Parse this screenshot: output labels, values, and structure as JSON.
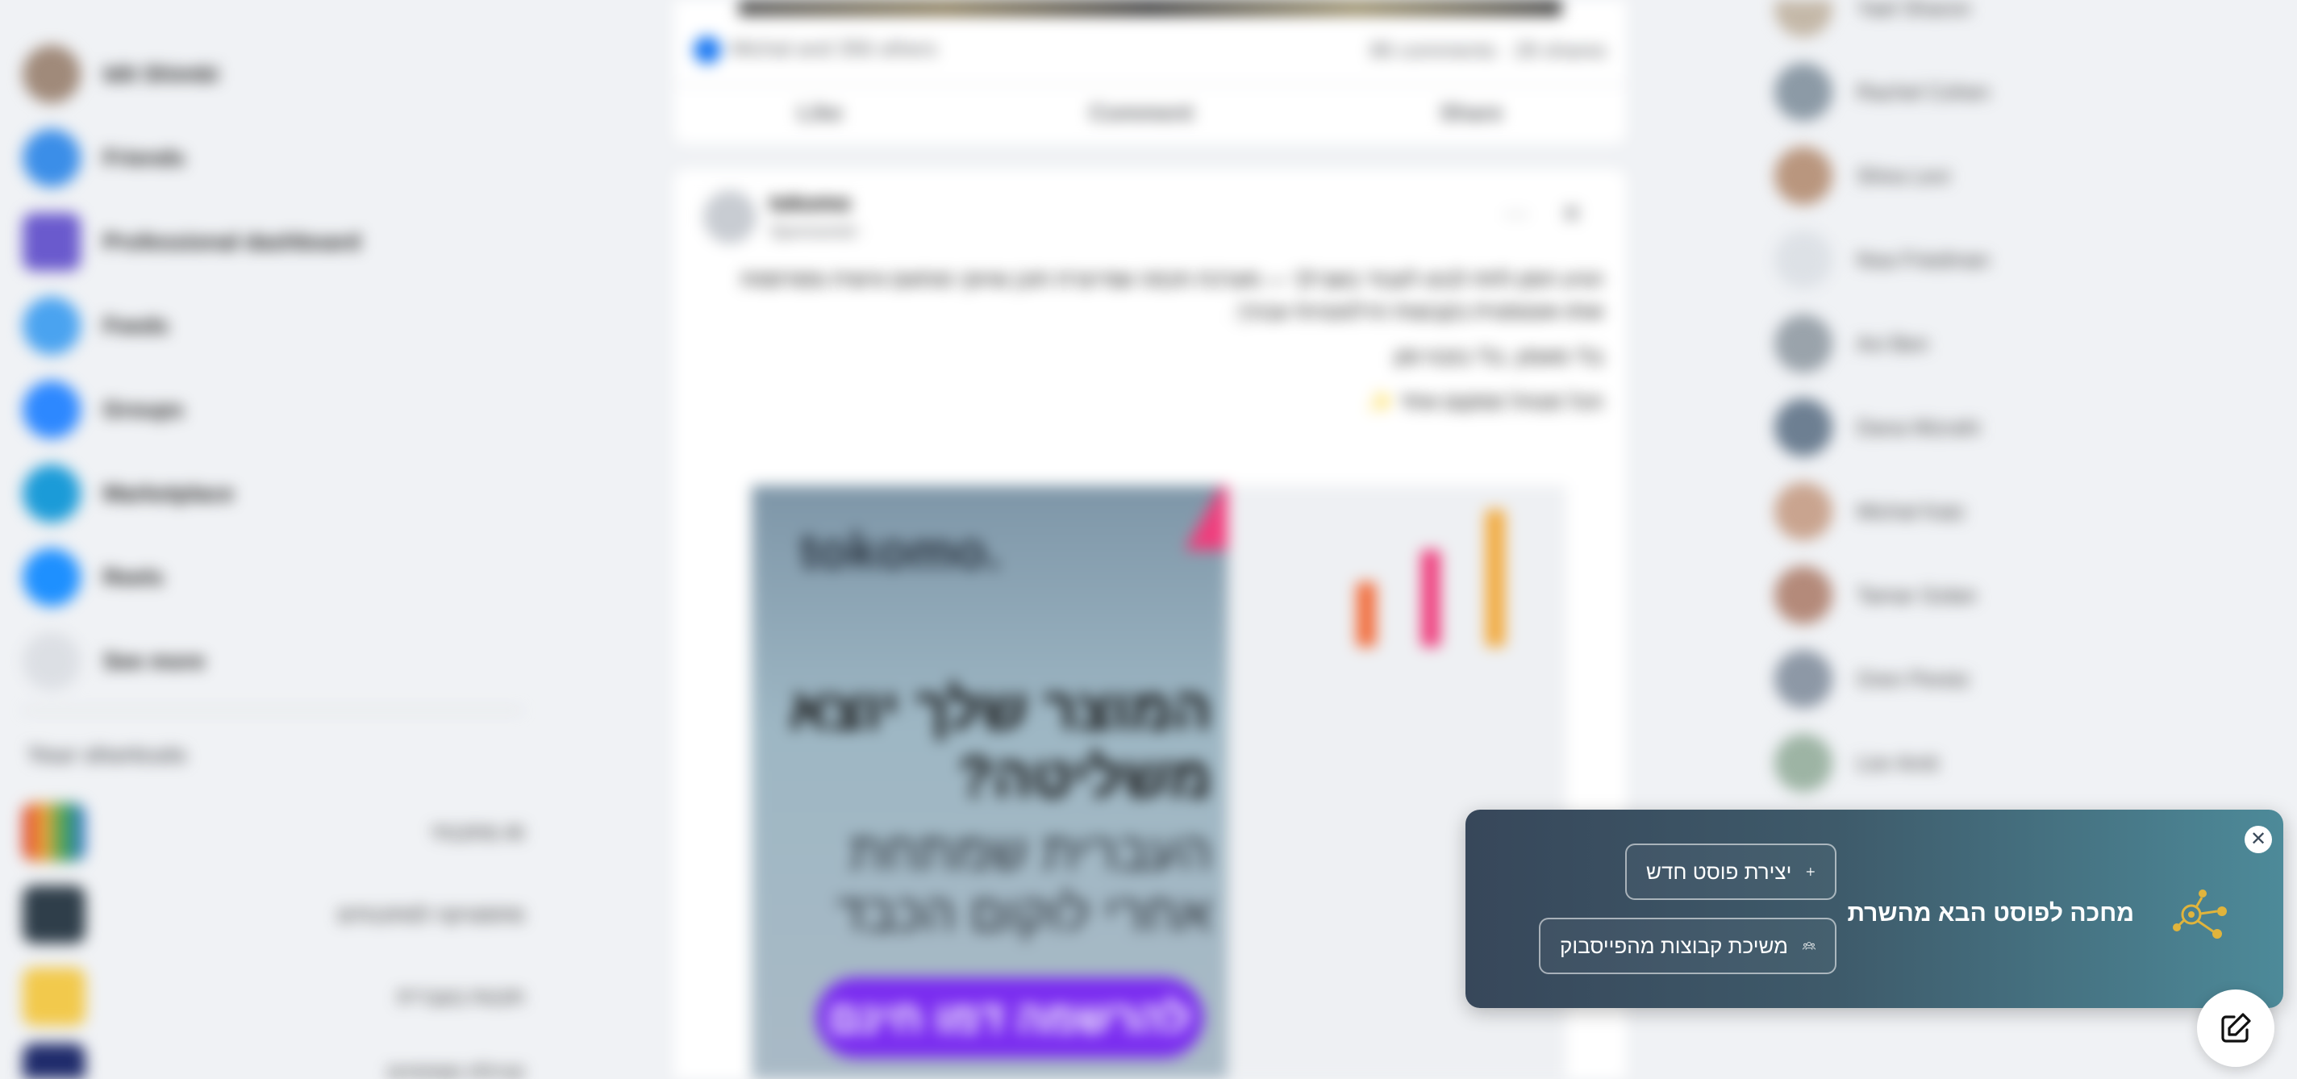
{
  "background": {
    "left_nav": [
      {
        "label": "Idit Shimbi",
        "icon": "profile-avatar",
        "color": "#a08a7a"
      },
      {
        "label": "Friends",
        "icon": "friends-icon",
        "color": "#3b8ee8"
      },
      {
        "label": "Professional dashboard",
        "icon": "dashboard-icon",
        "color": "#6a5acd"
      },
      {
        "label": "Feeds",
        "icon": "feeds-icon",
        "color": "#4aa3f0"
      },
      {
        "label": "Groups",
        "icon": "groups-icon",
        "color": "#2d88ff"
      },
      {
        "label": "Marketplace",
        "icon": "marketplace-icon",
        "color": "#1b9bd8"
      },
      {
        "label": "Reels",
        "icon": "reels-icon",
        "color": "#1e90ff"
      },
      {
        "label": "See more",
        "icon": "chevron-down-icon",
        "color": "#dcdfe4"
      }
    ],
    "shortcuts_title": "Your shortcuts",
    "shortcuts": [
      {
        "label": "מתכנתי AI",
        "color": "#d9342b"
      },
      {
        "label": "מתמטיקה למתכנתים",
        "color": "#2f3e4a"
      },
      {
        "label": "תכנות בעברית",
        "color": "#f2c94c"
      },
      {
        "label": "קהילת מפתחים",
        "color": "#1f2b6b"
      }
    ],
    "post_top": {
      "reaction_text": "Michal and 356 others",
      "counts": "86 comments · 28 shares",
      "actions": [
        "Like",
        "Comment",
        "Share"
      ]
    },
    "post": {
      "author": "tokomo",
      "meta": "Sponsored · ",
      "menu_glyph": "···",
      "close_glyph": "✕",
      "paragraphs": [
        "הגיע הזמן לתת לבוט לעבוד בשבילך — מערכת חכמה שמייצרת תוכן שיווקי מותאם אישית ומפרסמת אותו אוטומטית בקבוצות הרלוונטיות עבורך.",
        "בלי מאמץ, בלי בזבוז זמן",
        "הכל מנוהל ממקום אחד ✨"
      ],
      "ad": {
        "logo": "tokomo.",
        "headline": "המוצר שלך יוצא משליטה?",
        "sub": "העברית שמתחת אחרי לוקום הכבד",
        "cta": "להרשמה דמו חינם"
      }
    },
    "contacts": [
      {
        "name": "Yael Sharon",
        "color": "#c4b8a8"
      },
      {
        "name": "Rachel Cohen",
        "color": "#8c9aa6"
      },
      {
        "name": "Shira Levi",
        "color": "#b9967e"
      },
      {
        "name": "Noa Friedman",
        "color": "#dde1e6"
      },
      {
        "name": "Avi Ben",
        "color": "#9aa3ab"
      },
      {
        "name": "Dana Mizrahi",
        "color": "#6d7f92"
      },
      {
        "name": "Michal Katz",
        "color": "#c9a48f"
      },
      {
        "name": "Tamar Golan",
        "color": "#b48a7a"
      },
      {
        "name": "Oren Peretz",
        "color": "#8d98a6"
      },
      {
        "name": "Lior Amit",
        "color": "#9db4a4"
      }
    ]
  },
  "toast": {
    "title": "מחכה לפוסט הבא מהשרת",
    "close_glyph": "✕",
    "buttons": {
      "create_post": "יצירת פוסט חדש",
      "create_icon": "plus-icon",
      "import_groups": "משיכת קבוצות מהפייסבוק",
      "import_icon": "groups-icon"
    },
    "colors": {
      "accent": "#e0b43c",
      "bg_start": "#37475a",
      "bg_end": "#4d8a99"
    }
  },
  "fab": {
    "icon": "edit-icon"
  }
}
